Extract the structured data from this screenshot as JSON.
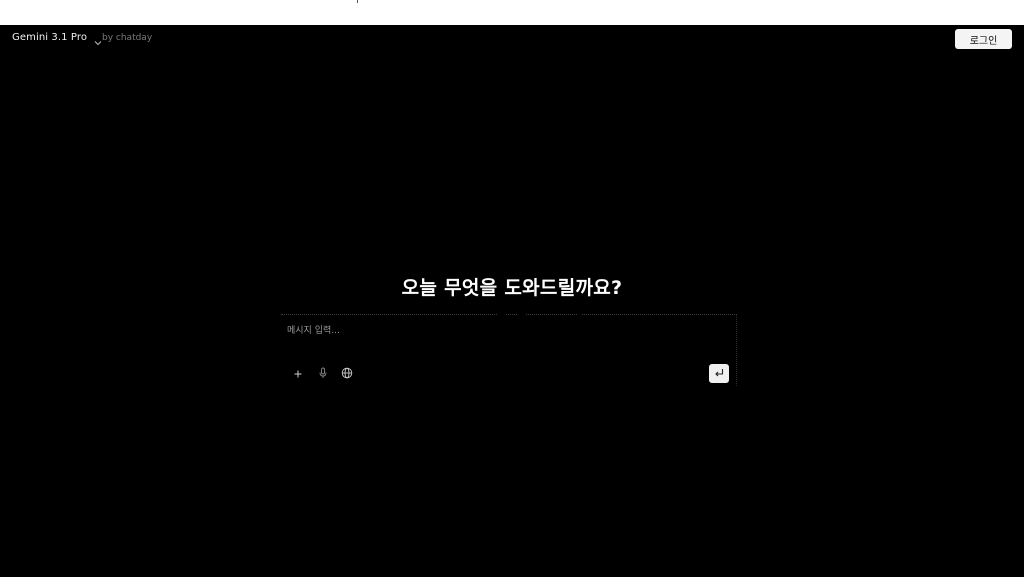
{
  "header": {
    "model_name": "Gemini 3.1 Pro",
    "byline": "by chatday",
    "login_label": "로그인"
  },
  "main": {
    "greeting": "오늘 무엇을 도와드릴까요?"
  },
  "composer": {
    "placeholder": "메시지 입력...",
    "value": ""
  },
  "icons": {
    "model_dropdown": "chevron-down-icon",
    "attach": "plus-icon",
    "voice": "microphone-icon",
    "web": "globe-icon",
    "send": "enter-return-icon"
  },
  "colors": {
    "background": "#000000",
    "text": "#ffffff",
    "muted": "#7a7a7a",
    "button_bg": "#f4f4f4"
  }
}
